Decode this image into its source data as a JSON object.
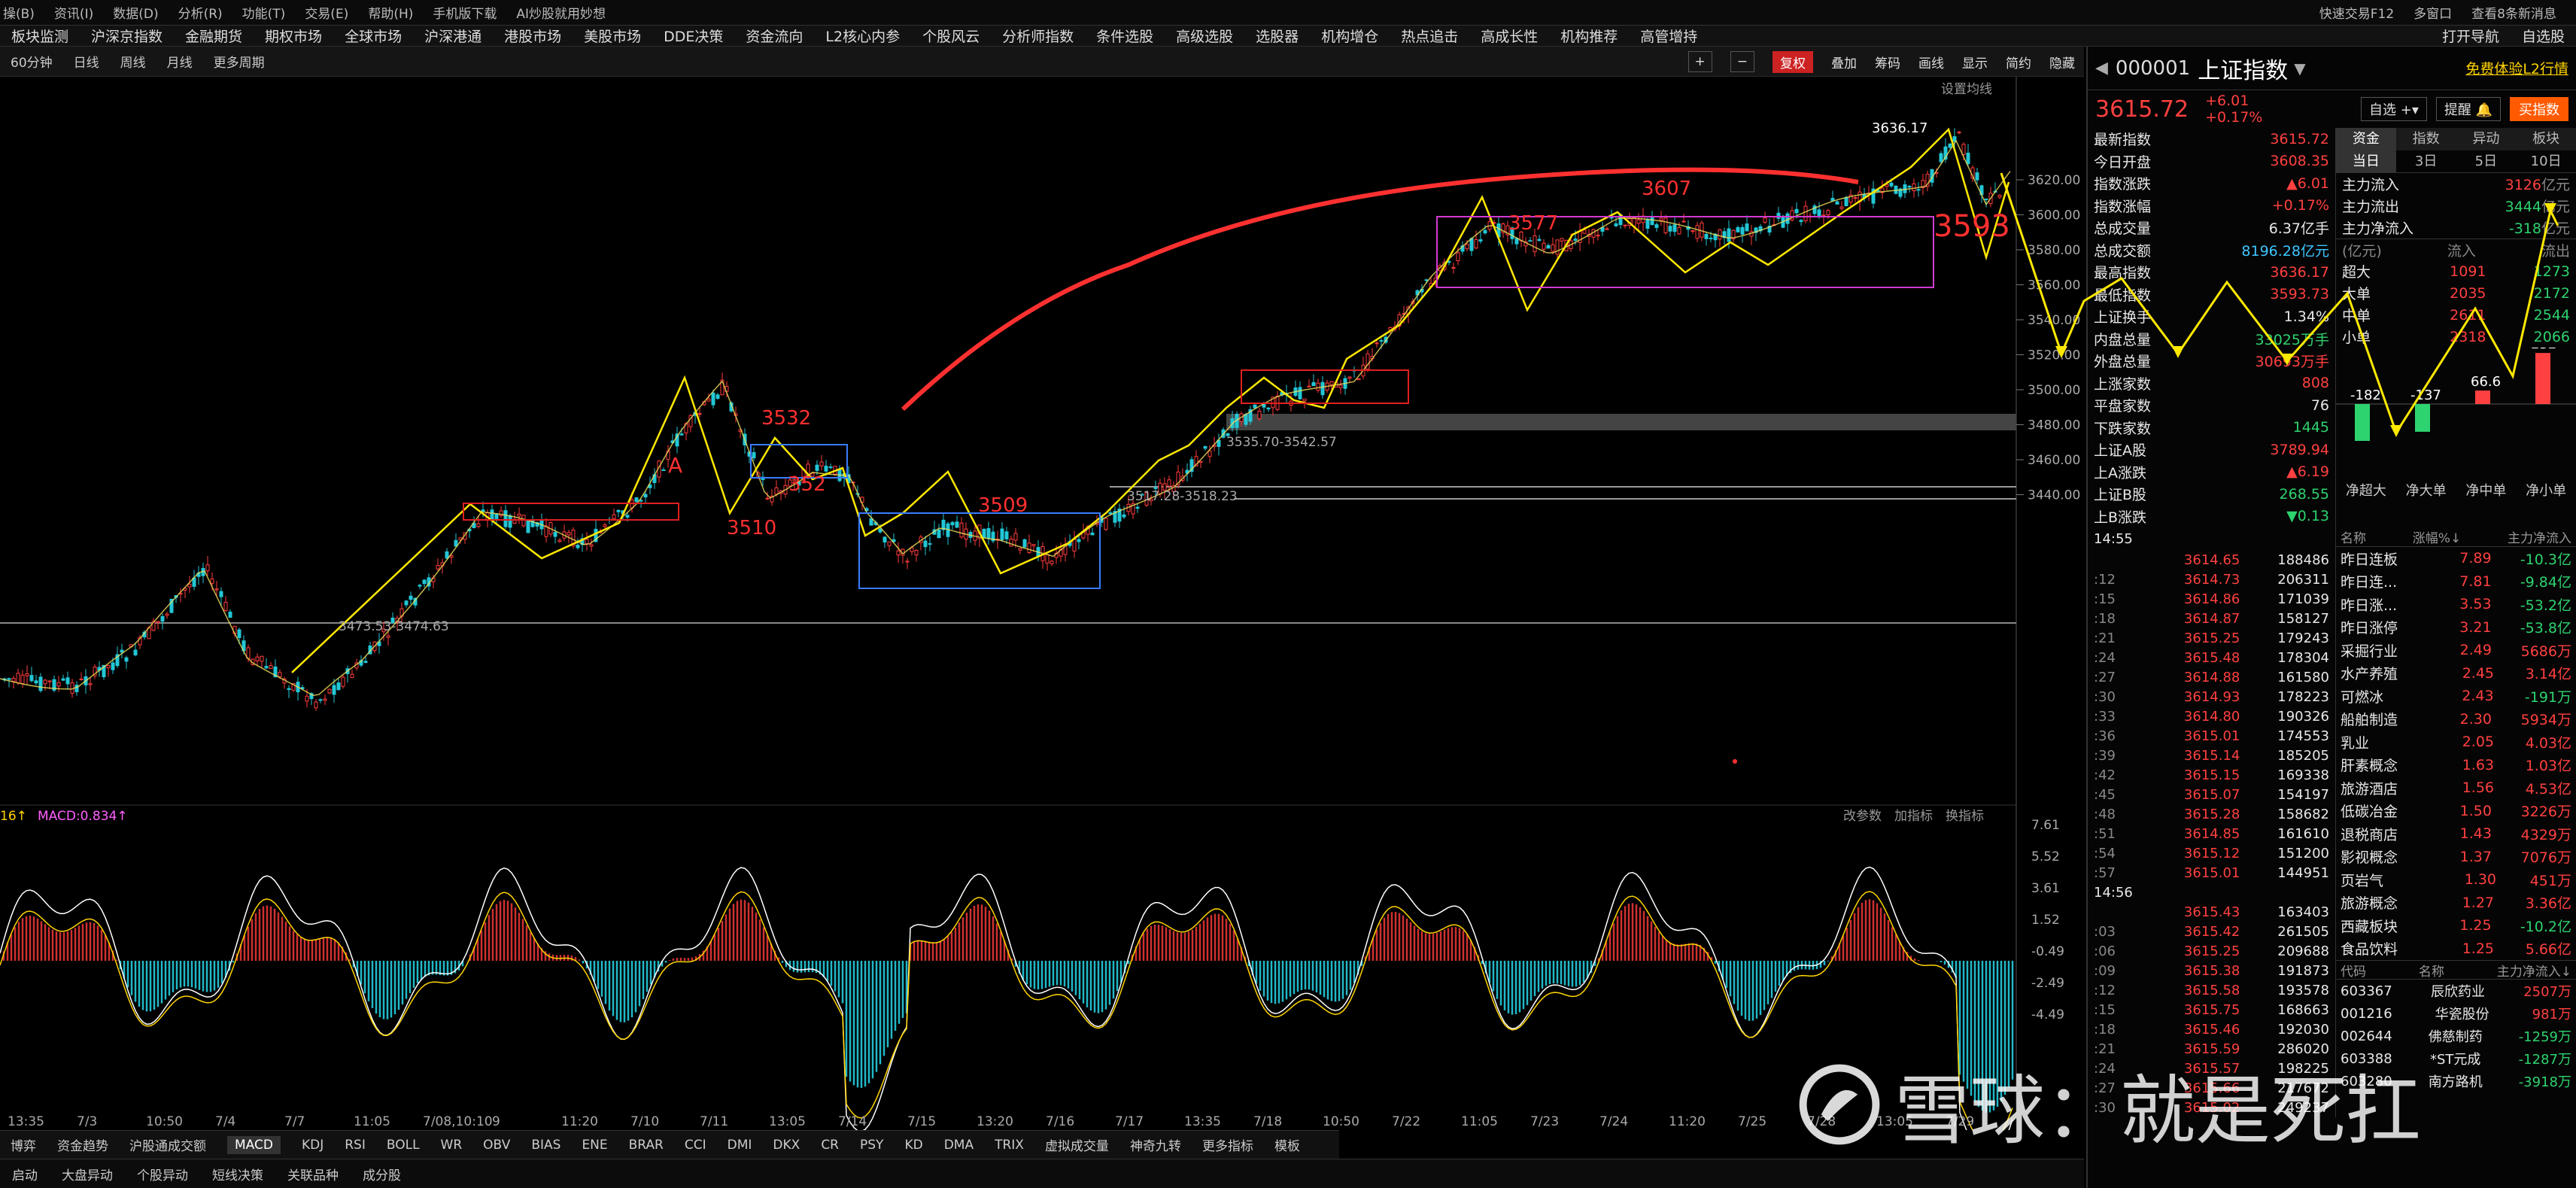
{
  "menubar": {
    "items": [
      "操(B)",
      "资讯(I)",
      "数据(D)",
      "分析(R)",
      "功能(T)",
      "交易(E)",
      "帮助(H)",
      "手机版下载",
      "AI炒股就用妙想",
      "快速交易F12",
      "多窗口",
      "查看8条新消息"
    ]
  },
  "topnav": {
    "items": [
      "板块监测",
      "沪深京指数",
      "金融期货",
      "期权市场",
      "全球市场",
      "沪深港通",
      "港股市场",
      "美股市场",
      "DDE决策",
      "资金流向",
      "L2核心内参",
      "个股风云",
      "分析师指数",
      "条件选股",
      "高级选股",
      "选股器",
      "机构增仓",
      "热点追击",
      "高成长性",
      "机构推荐",
      "高管增持",
      "打开导航",
      "自选股"
    ]
  },
  "periodbar": {
    "items": [
      "60分钟",
      "日线",
      "周线",
      "月线",
      "更多周期"
    ],
    "tools": [
      "+",
      "−",
      "复权",
      "叠加",
      "筹码",
      "画线",
      "显示",
      "简约",
      "隐藏"
    ]
  },
  "chart": {
    "settings_label": "设置均线",
    "y_ticks": [
      "3620.00",
      "3600.00",
      "3580.00",
      "3560.00",
      "3540.00",
      "3520.00",
      "3500.00",
      "3480.00",
      "3460.00",
      "3440.00"
    ],
    "annotations": {
      "high": "3636.17",
      "p3607": "3607",
      "p3577": "3577",
      "p3593": "3593",
      "p3532": "3532",
      "p352x": "352",
      "p3510": "3510",
      "p3509": "3509",
      "pA": "A",
      "range1": "3535.70-3542.57",
      "range2": "3517.28-3518.23",
      "range3": "3473.53-3474.63"
    },
    "macd": {
      "label_left": "16↑",
      "label": "MACD:0.834↑",
      "controls": [
        "改参数",
        "加指标",
        "换指标"
      ],
      "y_ticks": [
        "7.61",
        "5.52",
        "3.61",
        "1.52",
        "-0.49",
        "-2.49",
        "-4.49"
      ]
    },
    "x_axis": [
      "13:35",
      "7/3",
      "10:50",
      "7/4",
      "7/7",
      "11:05",
      "7/08,10:10",
      "9",
      "11:20",
      "7/10",
      "7/11",
      "13:05",
      "7/14",
      "7/15",
      "13:20",
      "7/16",
      "7/17",
      "13:35",
      "7/18",
      "10:50",
      "7/22",
      "11:05",
      "7/23",
      "7/24",
      "11:20",
      "7/25",
      "7/28",
      "13:05",
      "7/29"
    ]
  },
  "bottombar": {
    "items": [
      "博弈",
      "资金趋势",
      "沪股通成交额",
      "MACD",
      "KDJ",
      "RSI",
      "BOLL",
      "WR",
      "OBV",
      "BIAS",
      "ENE",
      "BRAR",
      "CCI",
      "DMI",
      "DKX",
      "CR",
      "PSY",
      "KD",
      "DMA",
      "TRIX",
      "虚拟成交量",
      "神奇九转",
      "更多指标",
      "模板"
    ],
    "active": "MACD"
  },
  "statusbar": {
    "items": [
      "启动",
      "大盘异动",
      "个股异动",
      "短线决策",
      "关联品种",
      "成分股"
    ]
  },
  "quote": {
    "code": "000001",
    "name": "上证指数",
    "price": "3615.72",
    "change": "+6.01",
    "change_pct": "+0.17%",
    "l2": "免费体验L2行情",
    "btn_fav": "自选",
    "btn_alert": "提醒",
    "btn_buy": "买指数",
    "rows": [
      {
        "k": "最新指数",
        "v": "3615.72",
        "c": "red"
      },
      {
        "k": "今日开盘",
        "v": "3608.35",
        "c": "red"
      },
      {
        "k": "指数涨跌",
        "v": "▲6.01",
        "c": "red"
      },
      {
        "k": "指数涨幅",
        "v": "+0.17%",
        "c": "red"
      },
      {
        "k": "总成交量",
        "v": "6.37亿手",
        "c": "white"
      },
      {
        "k": "总成交额",
        "v": "8196.28亿元",
        "c": "cyan"
      },
      {
        "k": "最高指数",
        "v": "3636.17",
        "c": "red"
      },
      {
        "k": "最低指数",
        "v": "3593.73",
        "c": "red"
      },
      {
        "k": "上证换手",
        "v": "1.34%",
        "c": "white"
      },
      {
        "k": "内盘总量",
        "v": "33025万手",
        "c": "green"
      },
      {
        "k": "外盘总量",
        "v": "30693万手",
        "c": "red"
      },
      {
        "k": "上涨家数",
        "v": "808",
        "c": "red"
      },
      {
        "k": "平盘家数",
        "v": "76",
        "c": "white"
      },
      {
        "k": "下跌家数",
        "v": "1445",
        "c": "green"
      },
      {
        "k": "上证A股",
        "v": "3789.94",
        "c": "red"
      },
      {
        "k": "上A涨跌",
        "v": "▲6.19",
        "c": "red"
      },
      {
        "k": "上证B股",
        "v": "268.55",
        "c": "green"
      },
      {
        "k": "上B涨跌",
        "v": "▼0.13",
        "c": "green"
      }
    ],
    "ticks_time1": "14:55",
    "ticks_time2": "14:56",
    "ticks": [
      {
        "t": "",
        "p": "3614.65",
        "v": "188486"
      },
      {
        "t": ":12",
        "p": "3614.73",
        "v": "206311"
      },
      {
        "t": ":15",
        "p": "3614.86",
        "v": "171039"
      },
      {
        "t": ":18",
        "p": "3614.87",
        "v": "158127"
      },
      {
        "t": ":21",
        "p": "3615.25",
        "v": "179243"
      },
      {
        "t": ":24",
        "p": "3615.48",
        "v": "178304"
      },
      {
        "t": ":27",
        "p": "3614.88",
        "v": "161580"
      },
      {
        "t": ":30",
        "p": "3614.93",
        "v": "178223"
      },
      {
        "t": ":33",
        "p": "3614.80",
        "v": "190326"
      },
      {
        "t": ":36",
        "p": "3615.01",
        "v": "174553"
      },
      {
        "t": ":39",
        "p": "3615.14",
        "v": "185205"
      },
      {
        "t": ":42",
        "p": "3615.15",
        "v": "169338"
      },
      {
        "t": ":45",
        "p": "3615.07",
        "v": "154197"
      },
      {
        "t": ":48",
        "p": "3615.28",
        "v": "158682"
      },
      {
        "t": ":51",
        "p": "3614.85",
        "v": "161610"
      },
      {
        "t": ":54",
        "p": "3615.12",
        "v": "151200"
      },
      {
        "t": ":57",
        "p": "3615.01",
        "v": "144951"
      },
      {
        "t": "",
        "p": "3615.43",
        "v": "163403"
      },
      {
        "t": ":03",
        "p": "3615.42",
        "v": "261505"
      },
      {
        "t": ":06",
        "p": "3615.25",
        "v": "209688"
      },
      {
        "t": ":09",
        "p": "3615.38",
        "v": "191873"
      },
      {
        "t": ":12",
        "p": "3615.58",
        "v": "193578"
      },
      {
        "t": ":15",
        "p": "3615.75",
        "v": "168663"
      },
      {
        "t": ":18",
        "p": "3615.46",
        "v": "192030"
      },
      {
        "t": ":21",
        "p": "3615.59",
        "v": "286020"
      },
      {
        "t": ":24",
        "p": "3615.57",
        "v": "198225"
      },
      {
        "t": ":27",
        "p": "3615.66",
        "v": "217672"
      },
      {
        "t": ":30",
        "p": "3615.02",
        "v": "249237"
      }
    ],
    "fund_tabs": [
      "资金",
      "指数",
      "异动",
      "板块"
    ],
    "period_tabs": [
      "当日",
      "3日",
      "5日",
      "10日"
    ],
    "flows": [
      {
        "k": "主力流入",
        "v": "3126",
        "u": "亿元",
        "c": "red"
      },
      {
        "k": "主力流出",
        "v": "3444",
        "u": "亿元",
        "c": "green"
      },
      {
        "k": "主力净流入",
        "v": "-318",
        "u": "亿元",
        "c": "green"
      }
    ],
    "flow_header": [
      "(亿元)",
      "流入",
      "流出"
    ],
    "flow_table": [
      {
        "k": "超大",
        "in": "1091",
        "out": "1273"
      },
      {
        "k": "大单",
        "in": "2035",
        "out": "2172"
      },
      {
        "k": "中单",
        "in": "2611",
        "out": "2544"
      },
      {
        "k": "小单",
        "in": "2318",
        "out": "2066"
      }
    ],
    "bars": {
      "values": [
        -182,
        -137,
        66.6,
        252
      ],
      "labels": [
        "-182",
        "-137",
        "66.6",
        "252"
      ],
      "cats": [
        "净超大",
        "净大单",
        "净中单",
        "净小单"
      ]
    },
    "sector_header": [
      "名称",
      "涨幅%↓",
      "主力净流入"
    ],
    "sectors": [
      {
        "n": "昨日连板",
        "p": "7.89",
        "f": "-10.3亿"
      },
      {
        "n": "昨日连...",
        "p": "7.81",
        "f": "-9.84亿"
      },
      {
        "n": "昨日涨...",
        "p": "3.53",
        "f": "-53.2亿"
      },
      {
        "n": "昨日涨停",
        "p": "3.21",
        "f": "-53.8亿"
      },
      {
        "n": "采掘行业",
        "p": "2.49",
        "f": "5686万"
      },
      {
        "n": "水产养殖",
        "p": "2.45",
        "f": "3.14亿"
      },
      {
        "n": "可燃冰",
        "p": "2.43",
        "f": "-191万"
      },
      {
        "n": "船舶制造",
        "p": "2.30",
        "f": "5934万"
      },
      {
        "n": "乳业",
        "p": "2.05",
        "f": "4.03亿"
      },
      {
        "n": "肝素概念",
        "p": "1.63",
        "f": "1.03亿"
      },
      {
        "n": "旅游酒店",
        "p": "1.56",
        "f": "4.53亿"
      },
      {
        "n": "低碳冶金",
        "p": "1.50",
        "f": "3226万"
      },
      {
        "n": "退税商店",
        "p": "1.43",
        "f": "4329万"
      },
      {
        "n": "影视概念",
        "p": "1.37",
        "f": "7076万"
      },
      {
        "n": "页岩气",
        "p": "1.30",
        "f": "451万"
      },
      {
        "n": "旅游概念",
        "p": "1.27",
        "f": "3.36亿"
      },
      {
        "n": "西藏板块",
        "p": "1.25",
        "f": "-10.2亿"
      },
      {
        "n": "食品饮料",
        "p": "1.25",
        "f": "5.66亿"
      }
    ],
    "stock_header": [
      "代码",
      "名称",
      "主力净流入↓"
    ],
    "stocks": [
      {
        "c": "603367",
        "n": "辰欣药业",
        "f": "2507万"
      },
      {
        "c": "001216",
        "n": "华瓷股份",
        "f": "981万"
      },
      {
        "c": "002644",
        "n": "佛慈制药",
        "f": "-1259万"
      },
      {
        "c": "603388",
        "n": "*ST元成",
        "f": "-1287万"
      },
      {
        "c": "603280",
        "n": "南方路机",
        "f": "-3918万"
      }
    ]
  },
  "watermark": {
    "brand": "雪球",
    "sep": "：",
    "author": "就是死扛"
  },
  "colors": {
    "up": "#ff3333",
    "down": "#2dd36f",
    "accent": "#ffd400",
    "macd": "#ffffff"
  }
}
